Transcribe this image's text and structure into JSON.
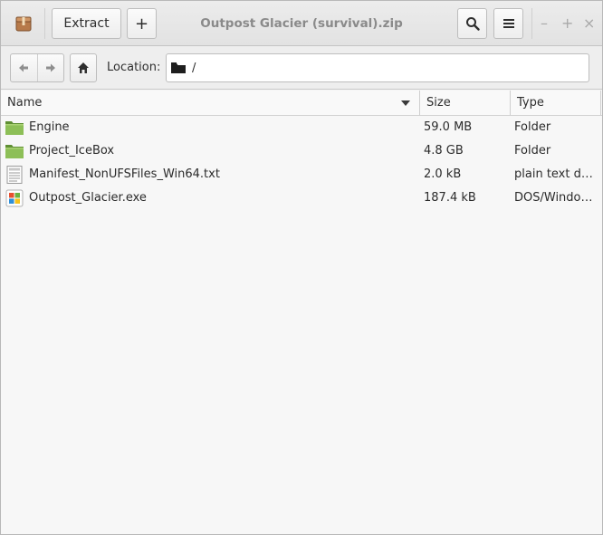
{
  "window": {
    "title": "Outpost Glacier (survival).zip"
  },
  "toolbar": {
    "extract_label": "Extract",
    "add_label": "+",
    "search_icon": "search-icon",
    "menu_icon": "hamburger-menu-icon",
    "window_controls": {
      "minimize": "–",
      "maximize": "+",
      "close": "×"
    }
  },
  "location": {
    "label": "Location:",
    "path": "/"
  },
  "columns": {
    "name": "Name",
    "size": "Size",
    "type": "Type",
    "sorted_by": "Name",
    "sort_order": "descending"
  },
  "files": [
    {
      "name": "Engine",
      "size": "59.0 MB",
      "type": "Folder",
      "icon": "folder-icon"
    },
    {
      "name": "Project_IceBox",
      "size": "4.8 GB",
      "type": "Folder",
      "icon": "folder-icon"
    },
    {
      "name": "Manifest_NonUFSFiles_Win64.txt",
      "size": "2.0 kB",
      "type": "plain text do…",
      "icon": "text-file-icon"
    },
    {
      "name": "Outpost_Glacier.exe",
      "size": "187.4 kB",
      "type": "DOS/Windo…",
      "icon": "windows-exe-icon"
    }
  ],
  "colors": {
    "folder_green": "#7fb04b",
    "title_text": "#8a8a8a"
  }
}
